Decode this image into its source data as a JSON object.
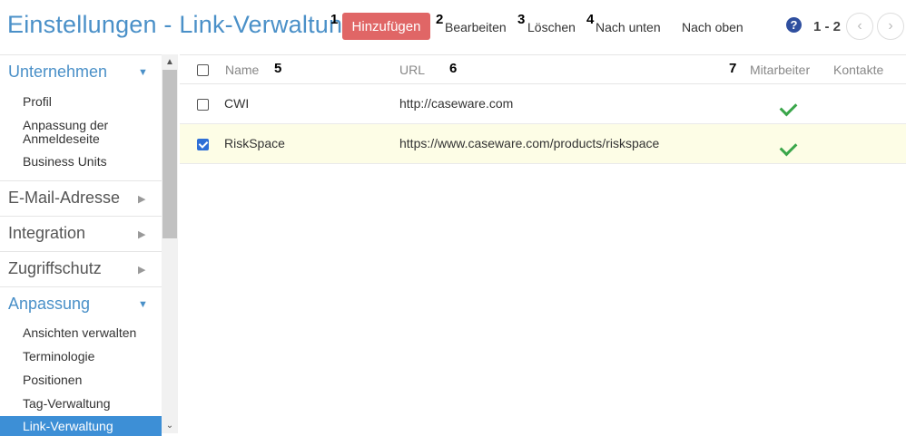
{
  "header": {
    "title": "Einstellungen - Link-Verwaltung",
    "steps": [
      "1",
      "2",
      "3",
      "4",
      "5",
      "6",
      "7"
    ],
    "toolbar": {
      "add_label": "Hinzufügen",
      "edit_label": "Bearbeiten",
      "delete_label": "Löschen",
      "move_down_label": "Nach unten",
      "move_up_label": "Nach oben"
    },
    "help_glyph": "?",
    "page_count": "1 - 2",
    "prev_glyph": "‹",
    "next_glyph": "›"
  },
  "sidebar": {
    "sections": [
      {
        "label": "Unternehmen",
        "expanded": true,
        "arrow": "▼"
      },
      {
        "label": "E-Mail-Adresse",
        "expanded": false,
        "arrow": "▶"
      },
      {
        "label": "Integration",
        "expanded": false,
        "arrow": "▶"
      },
      {
        "label": "Zugriffschutz",
        "expanded": false,
        "arrow": "▶"
      },
      {
        "label": "Anpassung",
        "expanded": true,
        "arrow": "▼"
      }
    ],
    "unternehmen_items": [
      "Profil",
      "Anpassung der Anmeldeseite",
      "Business Units"
    ],
    "anpassung_items": [
      "Ansichten verwalten",
      "Terminologie",
      "Positionen",
      "Tag-Verwaltung",
      "Link-Verwaltung"
    ],
    "active_item": "Link-Verwaltung"
  },
  "scrollbar": {
    "up_glyph": "▲",
    "down_glyph": "⌄"
  },
  "table": {
    "columns": [
      "Name",
      "URL",
      "Mitarbeiter",
      "Kontakte"
    ],
    "rows": [
      {
        "name": "CWI",
        "url": "http://caseware.com",
        "mitarbeiter": true,
        "kontakte": false,
        "selected": false
      },
      {
        "name": "RiskSpace",
        "url": "https://www.caseware.com/products/riskspace",
        "mitarbeiter": true,
        "kontakte": false,
        "selected": true
      }
    ]
  },
  "colors": {
    "accent": "#4a90c8",
    "add_button": "#e06666",
    "active_item": "#3d8fd6",
    "check": "#3aa64a",
    "selected_row": "#fdfde6"
  }
}
